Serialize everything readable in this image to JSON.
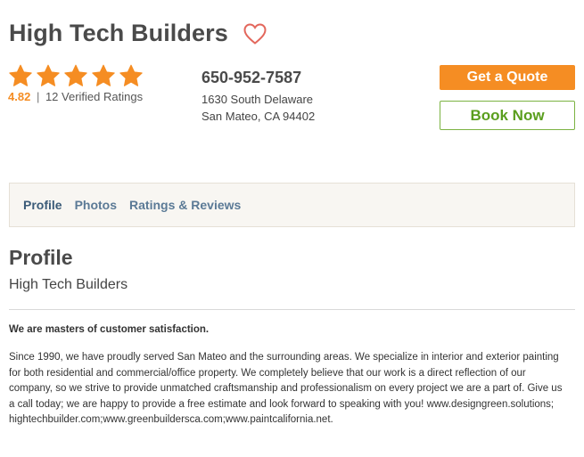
{
  "business": {
    "name": "High Tech Builders",
    "rating": "4.82",
    "rating_count_text": "12 Verified Ratings",
    "rating_separator": "|",
    "stars_filled": 5,
    "phone": "650-952-7587",
    "address_line1": "1630 South Delaware",
    "address_line2": "San Mateo, CA 94402"
  },
  "actions": {
    "quote_label": "Get a Quote",
    "book_label": "Book Now"
  },
  "tabs": [
    {
      "label": "Profile",
      "active": true
    },
    {
      "label": "Photos",
      "active": false
    },
    {
      "label": "Ratings & Reviews",
      "active": false
    }
  ],
  "profile": {
    "heading": "Profile",
    "subheading": "High Tech Builders",
    "headline": "We are masters of customer satisfaction.",
    "description": "Since 1990, we have proudly served San Mateo and the surrounding areas. We specialize in interior and exterior painting for both residential and commercial/office property. We completely believe that our work is a direct reflection of our company, so we strive to provide unmatched craftsmanship and professionalism on every project we are a part of. Give us a call today; we are happy to provide a free estimate and look forward to speaking with you! www.designgreen.solutions; hightechbuilder.com;www.greenbuildersca.com;www.paintcalifornia.net."
  },
  "colors": {
    "accent_orange": "#f58d23",
    "book_green": "#5a9e1e",
    "tab_blue": "#5b7a96",
    "heart": "#e3675c",
    "star": "#f58d23"
  },
  "icons": {
    "favorite": "heart-outline-icon",
    "rating": "star-icon"
  }
}
